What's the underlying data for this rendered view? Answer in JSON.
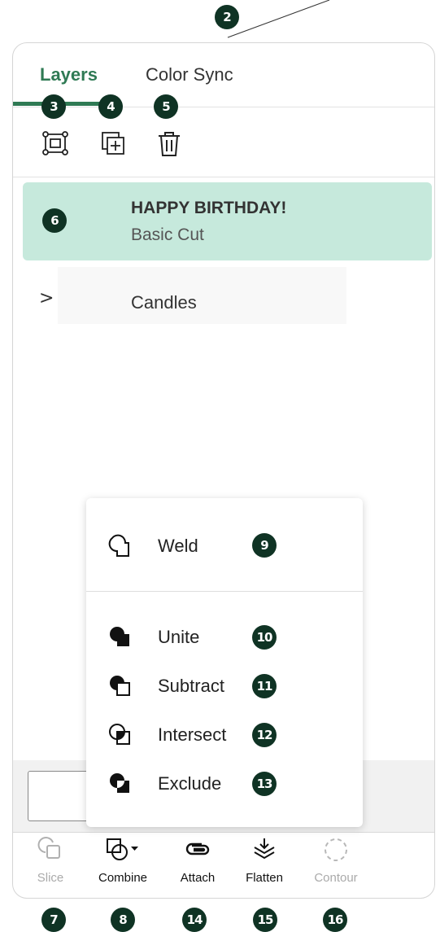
{
  "tabs": [
    {
      "label": "Layers",
      "active": true
    },
    {
      "label": "Color Sync",
      "active": false
    }
  ],
  "toolbar": {
    "group_icon": "group-icon",
    "duplicate_icon": "duplicate-icon",
    "delete_icon": "trash-icon"
  },
  "layers": {
    "selected": {
      "title": "HAPPY BIRTHDAY!",
      "subtitle": "Basic Cut"
    },
    "group": {
      "label": "Candles",
      "chevron": ">"
    }
  },
  "combine_menu": {
    "weld": "Weld",
    "unite": "Unite",
    "subtract": "Subtract",
    "intersect": "Intersect",
    "exclude": "Exclude"
  },
  "bottom_toolbar": [
    {
      "label": "Slice",
      "enabled": false
    },
    {
      "label": "Combine",
      "enabled": true
    },
    {
      "label": "Attach",
      "enabled": true
    },
    {
      "label": "Flatten",
      "enabled": true
    },
    {
      "label": "Contour",
      "enabled": false
    }
  ],
  "badges": {
    "b2": "2",
    "b3": "3",
    "b4": "4",
    "b5": "5",
    "b6": "6",
    "b7": "7",
    "b8": "8",
    "b9": "9",
    "b10": "10",
    "b11": "11",
    "b12": "12",
    "b13": "13",
    "b14": "14",
    "b15": "15",
    "b16": "16"
  },
  "colors": {
    "accent": "#2f7a54",
    "selected_row": "#c6e9dc",
    "badge": "#0f3324"
  }
}
